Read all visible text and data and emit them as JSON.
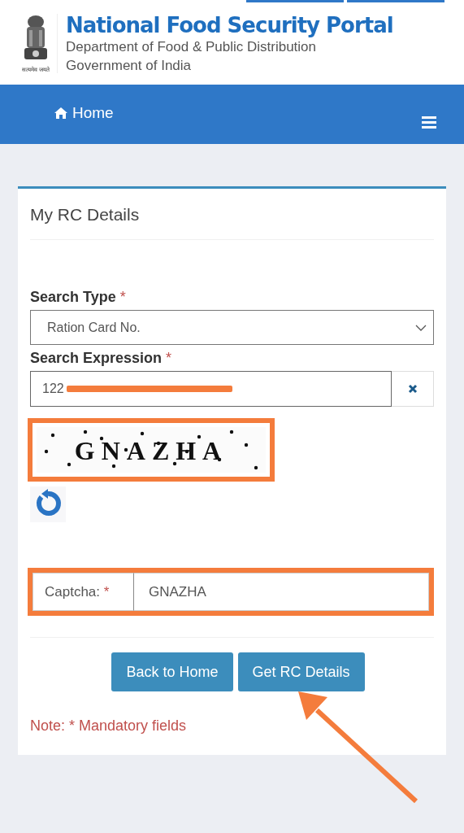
{
  "header": {
    "title": "National Food Security Portal",
    "subtitle": "Department of Food & Public Distribution",
    "org": "Government of India",
    "motto": "सत्यमेव जयते"
  },
  "nav": {
    "home": "Home"
  },
  "card": {
    "title": "My RC Details",
    "search_type": {
      "label": "Search Type",
      "required": "*",
      "value": "Ration Card No."
    },
    "search_expression": {
      "label": "Search Expression",
      "required": "*",
      "value": "122",
      "redacted": true
    },
    "captcha": {
      "image_text": "GNAZHA",
      "label": "Captcha:",
      "required": "*",
      "value": "GNAZHA"
    },
    "buttons": [
      "Back to Home",
      "Get RC Details"
    ],
    "note": "Note: * Mandatory fields"
  },
  "annotations": {
    "frame_captcha_image": true,
    "frame_captcha_input": true,
    "arrow_to_button": true
  }
}
